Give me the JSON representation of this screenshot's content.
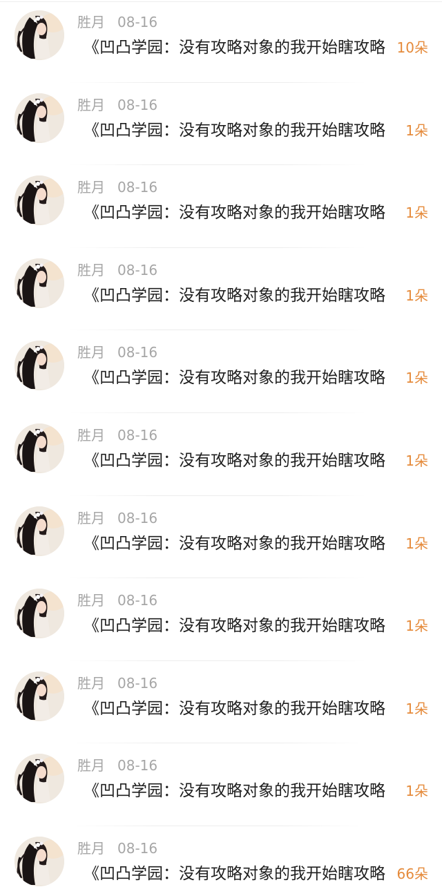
{
  "list": {
    "items": [
      {
        "user": "胜月",
        "date": "08-16",
        "title": "《凹凸学园：没有攻略对象的我开始瞎攻略",
        "count": "10朵",
        "avatar": "avatar-girl-long-hair"
      },
      {
        "user": "胜月",
        "date": "08-16",
        "title": "《凹凸学园：没有攻略对象的我开始瞎攻略",
        "count": "1朵",
        "avatar": "avatar-girl-long-hair"
      },
      {
        "user": "胜月",
        "date": "08-16",
        "title": "《凹凸学园：没有攻略对象的我开始瞎攻略",
        "count": "1朵",
        "avatar": "avatar-girl-long-hair"
      },
      {
        "user": "胜月",
        "date": "08-16",
        "title": "《凹凸学园：没有攻略对象的我开始瞎攻略",
        "count": "1朵",
        "avatar": "avatar-girl-long-hair"
      },
      {
        "user": "胜月",
        "date": "08-16",
        "title": "《凹凸学园：没有攻略对象的我开始瞎攻略",
        "count": "1朵",
        "avatar": "avatar-girl-long-hair"
      },
      {
        "user": "胜月",
        "date": "08-16",
        "title": "《凹凸学园：没有攻略对象的我开始瞎攻略",
        "count": "1朵",
        "avatar": "avatar-girl-long-hair"
      },
      {
        "user": "胜月",
        "date": "08-16",
        "title": "《凹凸学园：没有攻略对象的我开始瞎攻略",
        "count": "1朵",
        "avatar": "avatar-girl-long-hair"
      },
      {
        "user": "胜月",
        "date": "08-16",
        "title": "《凹凸学园：没有攻略对象的我开始瞎攻略",
        "count": "1朵",
        "avatar": "avatar-girl-long-hair"
      },
      {
        "user": "胜月",
        "date": "08-16",
        "title": "《凹凸学园：没有攻略对象的我开始瞎攻略",
        "count": "1朵",
        "avatar": "avatar-girl-long-hair"
      },
      {
        "user": "胜月",
        "date": "08-16",
        "title": "《凹凸学园：没有攻略对象的我开始瞎攻略",
        "count": "1朵",
        "avatar": "avatar-girl-long-hair"
      },
      {
        "user": "胜月",
        "date": "08-16",
        "title": "《凹凸学园：没有攻略对象的我开始瞎攻略",
        "count": "66朵",
        "avatar": "avatar-girl-long-hair"
      }
    ]
  },
  "colors": {
    "username": "#a6a6a6",
    "title": "#1f1f1f",
    "count": "#e58a3a",
    "divider": "#ececec"
  }
}
